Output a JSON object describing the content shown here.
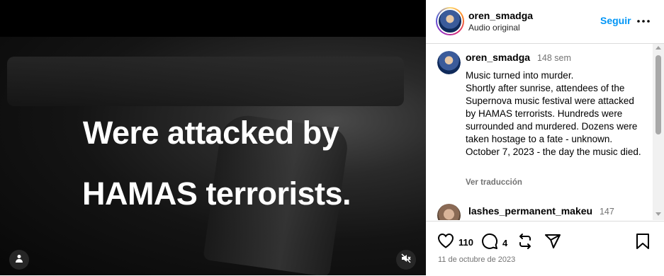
{
  "media": {
    "line1": "Were attacked by",
    "line2": "HAMAS terrorists."
  },
  "header": {
    "username": "oren_smadga",
    "audio": "Audio original",
    "follow": "Seguir"
  },
  "post": {
    "username": "oren_smadga",
    "time": "148 sem",
    "caption_lines": [
      "Music turned into murder.",
      "Shortly after sunrise, attendees of the Supernova music festival were attacked by HAMAS terrorists. Hundreds were surrounded and murdered. Dozens were taken hostage to a fate - unknown.",
      "October 7, 2023 - the day the music died."
    ],
    "translate": "Ver traducción"
  },
  "comment": {
    "username": "lashes_permanent_makeu",
    "time": "147"
  },
  "actions": {
    "likes": "110",
    "comments": "4",
    "date": "11 de octubre de 2023"
  },
  "colors": {
    "accent": "#0095f6",
    "muted": "#737373",
    "border": "#dbdbdb"
  }
}
